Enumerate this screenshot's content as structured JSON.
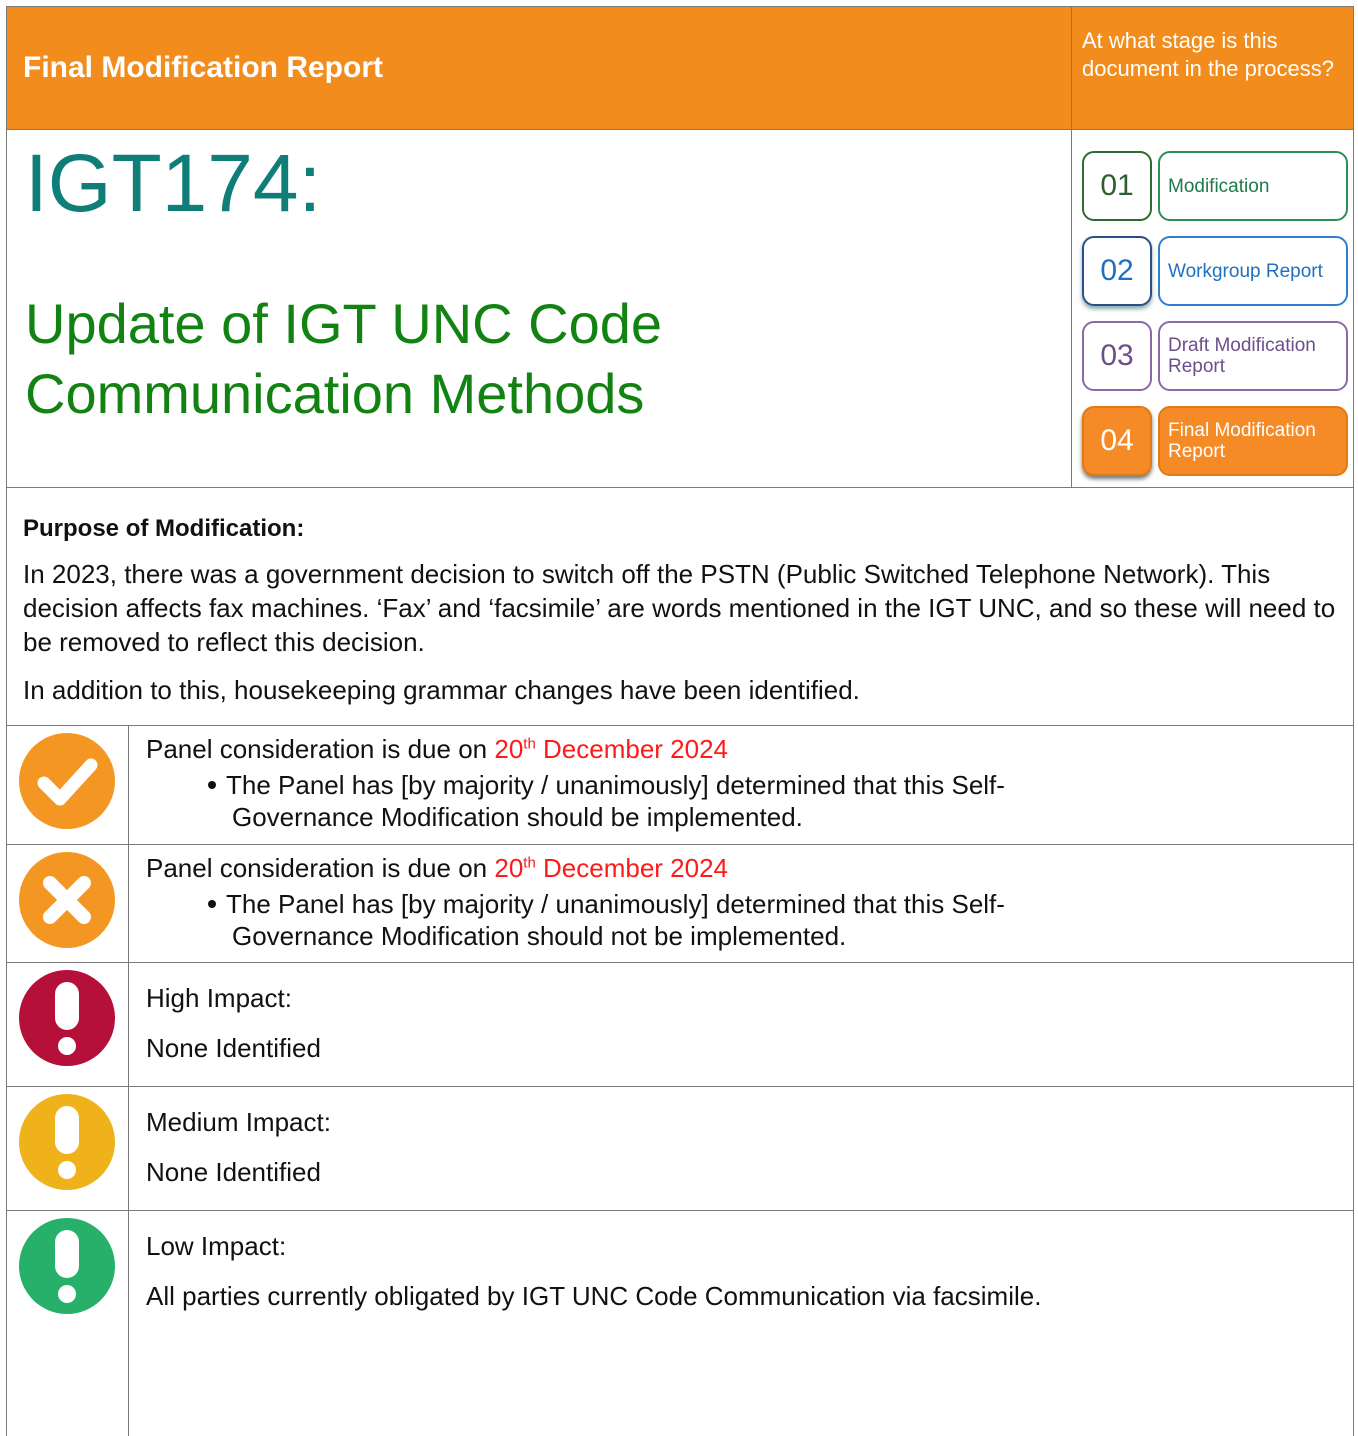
{
  "header": {
    "title": "Final Modification Report",
    "stage_question": "At what stage is this document in the process?"
  },
  "modification": {
    "id": "IGT174:",
    "title_line1": "Update of IGT UNC Code",
    "title_line2": "Communication Methods"
  },
  "stages": [
    {
      "number": "01",
      "label": "Modification",
      "color": "#2c8f5a"
    },
    {
      "number": "02",
      "label": "Workgroup Report",
      "color": "#2f7fd1"
    },
    {
      "number": "03",
      "label": "Draft Modification Report",
      "color": "#8c6aa8"
    },
    {
      "number": "04",
      "label": "Final Modification Report",
      "color": "#f58b26",
      "current": true
    }
  ],
  "purpose": {
    "heading": "Purpose of Modification:",
    "paragraph1": "In 2023, there was a government decision to switch off the PSTN (Public Switched Telephone Network). This decision affects fax machines. ‘Fax’ and ‘facsimile’ are words mentioned in the IGT UNC, and so these will need to be removed to reflect this decision.",
    "paragraph2": "In addition to this, housekeeping grammar changes have been identified."
  },
  "decisions": {
    "implement": {
      "icon": "check-icon",
      "prefix": "Panel consideration is due on ",
      "date_day": "20",
      "date_suffix": "th",
      "date_rest": " December 2024",
      "bullet_line1": "The Panel has [by majority / unanimously] determined that this Self-",
      "bullet_line2": "Governance Modification should be implemented."
    },
    "reject": {
      "icon": "cross-icon",
      "prefix": "Panel consideration is due on ",
      "date_day": "20",
      "date_suffix": "th",
      "date_rest": " December 2024",
      "bullet_line1": "The Panel has [by majority / unanimously] determined that this Self-",
      "bullet_line2": "Governance Modification should not be implemented."
    }
  },
  "impacts": {
    "high": {
      "icon": "exclamation-icon",
      "color": "#b5103a",
      "label": "High Impact:",
      "value": "None Identified"
    },
    "medium": {
      "icon": "exclamation-icon",
      "color": "#f0b21a",
      "label": "Medium Impact:",
      "value": "None Identified"
    },
    "low": {
      "icon": "exclamation-icon",
      "color": "#27b06a",
      "label": "Low Impact:",
      "value": "All parties currently obligated by IGT UNC Code Communication via facsimile."
    }
  },
  "colors": {
    "orange": "#f28c1c",
    "red_date": "#ff1a1a"
  }
}
